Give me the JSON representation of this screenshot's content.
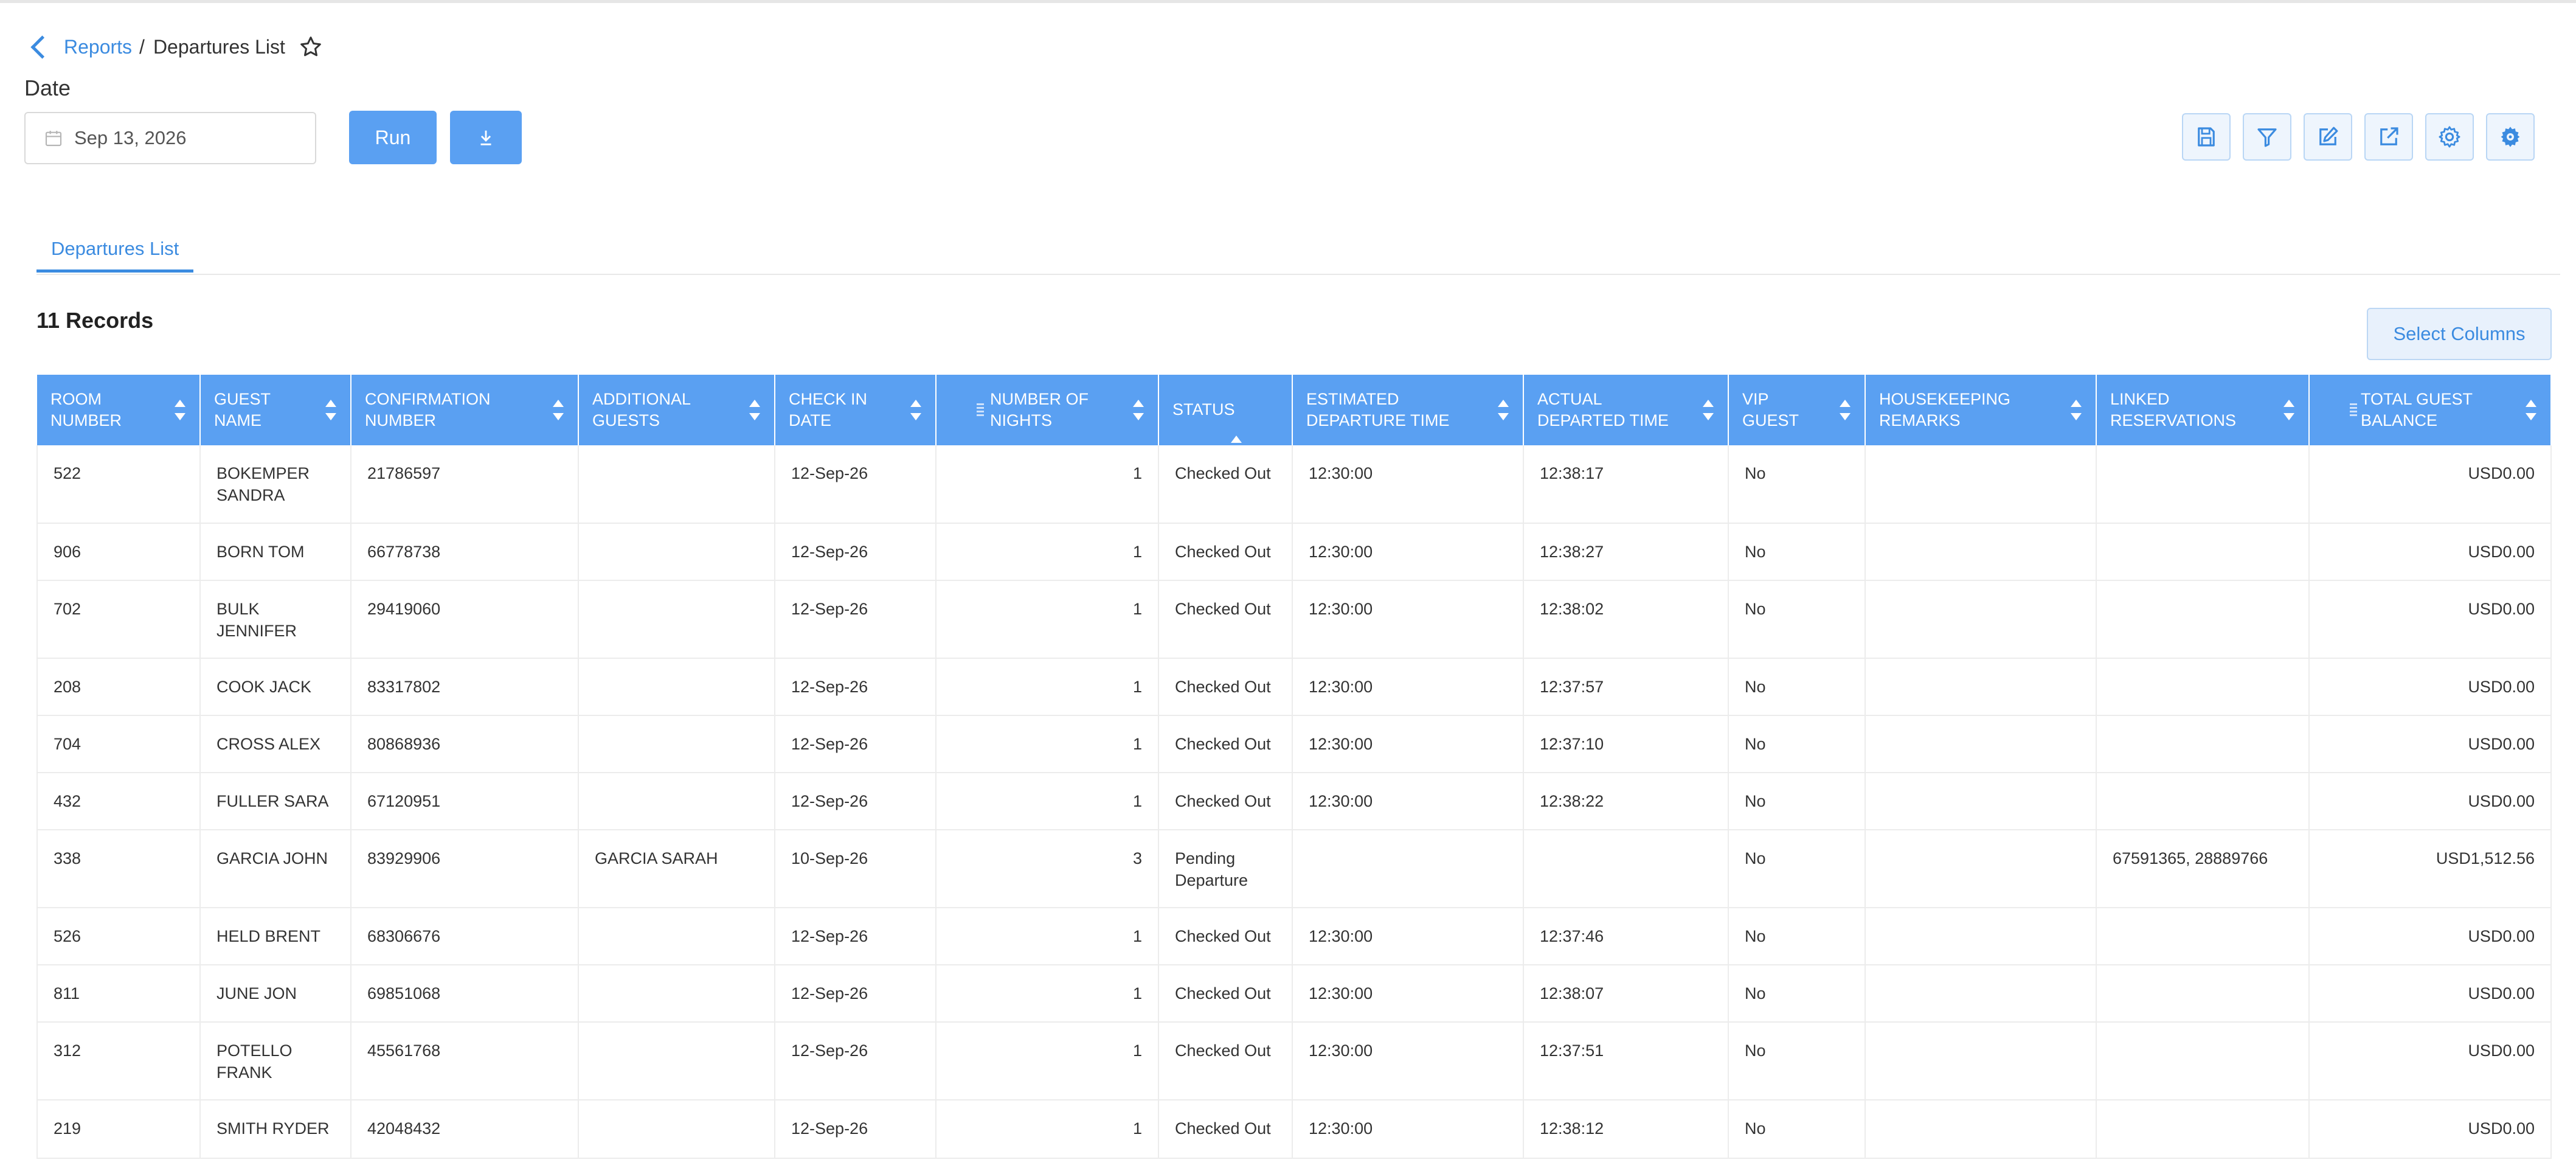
{
  "breadcrumb": {
    "parent": "Reports",
    "separator": "/",
    "current": "Departures List"
  },
  "filters": {
    "date_label": "Date",
    "date_value": "Sep 13, 2026"
  },
  "actions": {
    "run_label": "Run"
  },
  "toolbar_icons": [
    "save-icon",
    "filter-icon",
    "edit-icon",
    "external-link-icon",
    "settings-icon",
    "settings-advanced-icon"
  ],
  "tabs": [
    {
      "label": "Departures List"
    }
  ],
  "records_label": "11 Records",
  "select_columns_label": "Select Columns",
  "colors": {
    "accent": "#5aa0f2",
    "link": "#3b8be0"
  },
  "table": {
    "columns": [
      "ROOM NUMBER",
      "GUEST NAME",
      "CONFIRMATION NUMBER",
      "ADDITIONAL GUESTS",
      "CHECK IN DATE",
      "NUMBER OF NIGHTS",
      "STATUS",
      "ESTIMATED DEPARTURE TIME",
      "ACTUAL DEPARTED TIME",
      "VIP GUEST",
      "HOUSEKEEPING REMARKS",
      "LINKED RESERVATIONS",
      "TOTAL GUEST BALANCE"
    ],
    "rows": [
      [
        "522",
        "BOKEMPER SANDRA",
        "21786597",
        "",
        "12-Sep-26",
        "1",
        "Checked Out",
        "12:30:00",
        "12:38:17",
        "No",
        "",
        "",
        "USD0.00"
      ],
      [
        "906",
        "BORN TOM",
        "66778738",
        "",
        "12-Sep-26",
        "1",
        "Checked Out",
        "12:30:00",
        "12:38:27",
        "No",
        "",
        "",
        "USD0.00"
      ],
      [
        "702",
        "BULK JENNIFER",
        "29419060",
        "",
        "12-Sep-26",
        "1",
        "Checked Out",
        "12:30:00",
        "12:38:02",
        "No",
        "",
        "",
        "USD0.00"
      ],
      [
        "208",
        "COOK JACK",
        "83317802",
        "",
        "12-Sep-26",
        "1",
        "Checked Out",
        "12:30:00",
        "12:37:57",
        "No",
        "",
        "",
        "USD0.00"
      ],
      [
        "704",
        "CROSS ALEX",
        "80868936",
        "",
        "12-Sep-26",
        "1",
        "Checked Out",
        "12:30:00",
        "12:37:10",
        "No",
        "",
        "",
        "USD0.00"
      ],
      [
        "432",
        "FULLER SARA",
        "67120951",
        "",
        "12-Sep-26",
        "1",
        "Checked Out",
        "12:30:00",
        "12:38:22",
        "No",
        "",
        "",
        "USD0.00"
      ],
      [
        "338",
        "GARCIA JOHN",
        "83929906",
        "GARCIA SARAH",
        "10-Sep-26",
        "3",
        "Pending Departure",
        "",
        "",
        "No",
        "",
        "67591365, 28889766",
        "USD1,512.56"
      ],
      [
        "526",
        "HELD BRENT",
        "68306676",
        "",
        "12-Sep-26",
        "1",
        "Checked Out",
        "12:30:00",
        "12:37:46",
        "No",
        "",
        "",
        "USD0.00"
      ],
      [
        "811",
        "JUNE JON",
        "69851068",
        "",
        "12-Sep-26",
        "1",
        "Checked Out",
        "12:30:00",
        "12:38:07",
        "No",
        "",
        "",
        "USD0.00"
      ],
      [
        "312",
        "POTELLO FRANK",
        "45561768",
        "",
        "12-Sep-26",
        "1",
        "Checked Out",
        "12:30:00",
        "12:37:51",
        "No",
        "",
        "",
        "USD0.00"
      ],
      [
        "219",
        "SMITH RYDER",
        "42048432",
        "",
        "12-Sep-26",
        "1",
        "Checked Out",
        "12:30:00",
        "12:38:12",
        "No",
        "",
        "",
        "USD0.00"
      ]
    ]
  }
}
